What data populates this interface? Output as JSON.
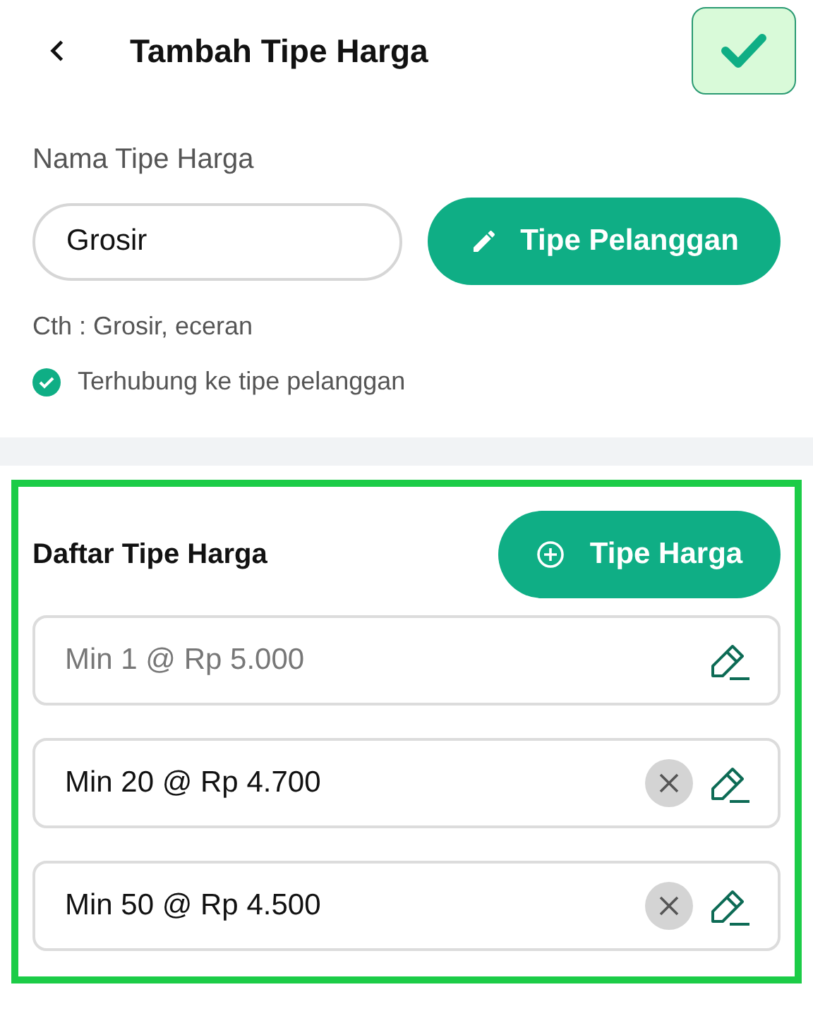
{
  "header": {
    "title": "Tambah Tipe Harga"
  },
  "name_field": {
    "label": "Nama Tipe Harga",
    "value": "Grosir",
    "hint": "Cth : Grosir, eceran",
    "linked": true,
    "linked_text": "Terhubung ke tipe pelanggan"
  },
  "customer_type_button": "Tipe Pelanggan",
  "price_list": {
    "title": "Daftar Tipe Harga",
    "add_button": "Tipe Harga",
    "rows": [
      {
        "text": "Min 1 @ Rp 5.000",
        "disabled": true,
        "removable": false
      },
      {
        "text": "Min 20 @ Rp 4.700",
        "disabled": false,
        "removable": true
      },
      {
        "text": "Min 50 @ Rp 4.500",
        "disabled": false,
        "removable": true
      }
    ]
  }
}
